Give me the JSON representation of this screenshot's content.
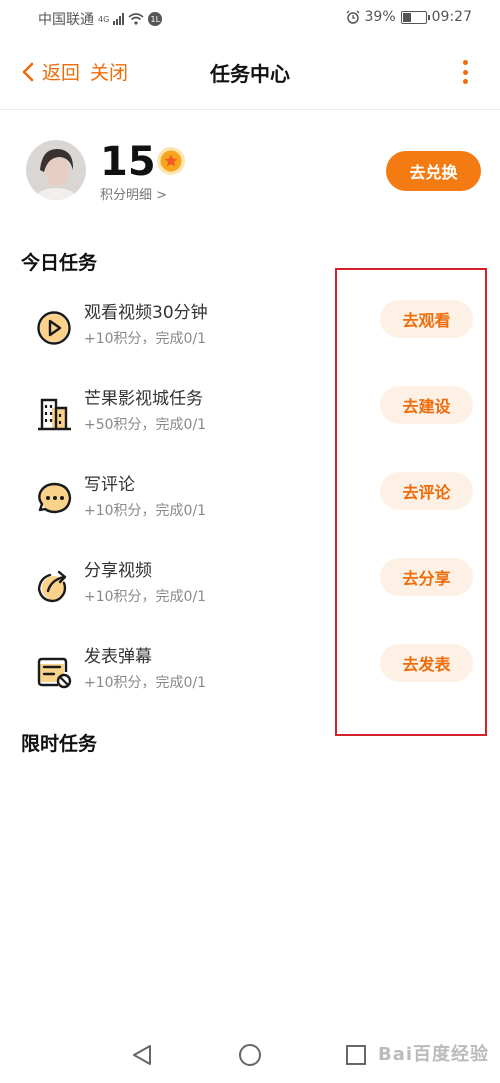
{
  "status_bar": {
    "carrier": "中国联通",
    "network_badge": "4G",
    "notification_badge": "1L",
    "battery_percent": "39%",
    "battery_level": 0.39,
    "time": "09:27"
  },
  "header": {
    "back_label": "返回",
    "close_label": "关闭",
    "title": "任务中心"
  },
  "profile": {
    "points": "15",
    "points_detail": "积分明细 >",
    "exchange_label": "去兑换"
  },
  "daily": {
    "title": "今日任务",
    "tasks": [
      {
        "name": "观看视频30分钟",
        "desc": "+10积分，完成0/1",
        "action": "去观看",
        "icon": "play-icon"
      },
      {
        "name": "芒果影视城任务",
        "desc": "+50积分，完成0/1",
        "action": "去建设",
        "icon": "building-icon"
      },
      {
        "name": "写评论",
        "desc": "+10积分，完成0/1",
        "action": "去评论",
        "icon": "comment-icon"
      },
      {
        "name": "分享视频",
        "desc": "+10积分，完成0/1",
        "action": "去分享",
        "icon": "share-icon"
      },
      {
        "name": "发表弹幕",
        "desc": "+10积分，完成0/1",
        "action": "去发表",
        "icon": "danmaku-icon"
      }
    ]
  },
  "limited": {
    "title": "限时任务"
  },
  "watermark": "Bai百度经验",
  "colors": {
    "accent": "#ef6c0b",
    "button_bg": "#f47a12",
    "task_button_bg": "#fdf1e6",
    "highlight_border": "#d4202a"
  }
}
